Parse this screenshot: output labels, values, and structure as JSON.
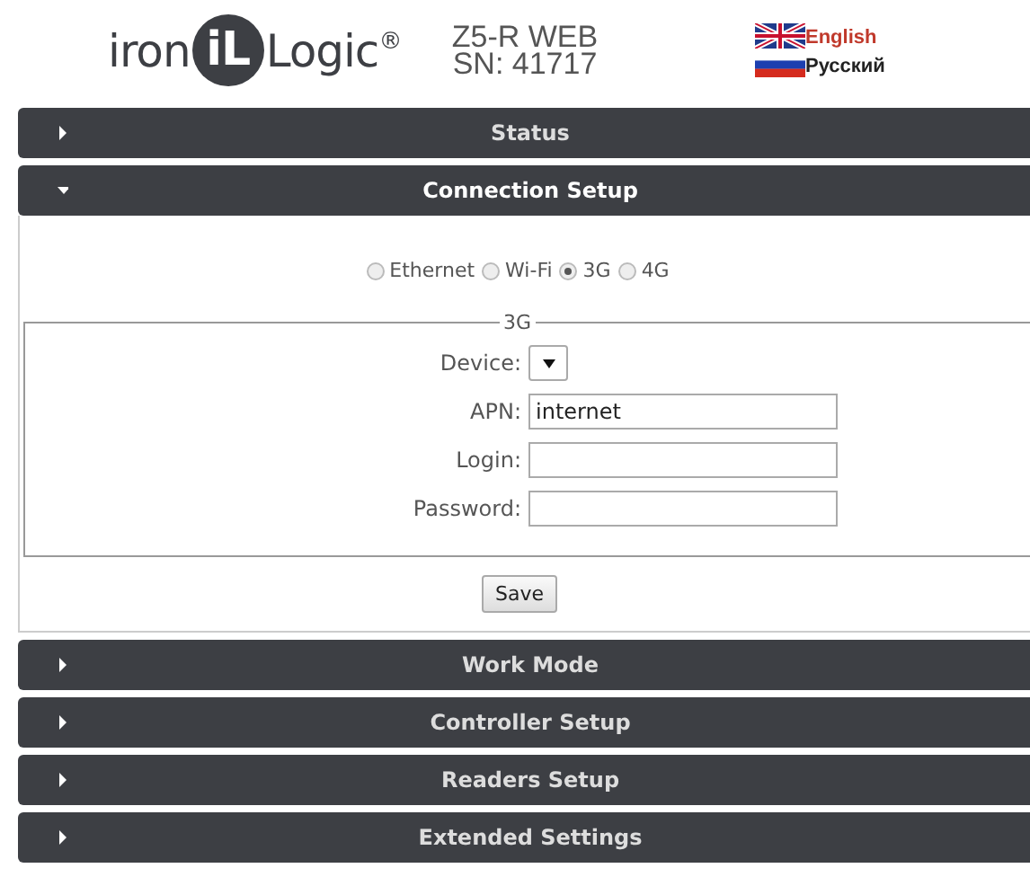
{
  "header": {
    "logo": {
      "left": "iron",
      "mark": "iL",
      "right": "Logic",
      "registered": "®"
    },
    "model": "Z5-R WEB",
    "serial": "SN: 41717",
    "languages": [
      {
        "label": "English",
        "kind": "uk",
        "selected": true
      },
      {
        "label": "Русский",
        "kind": "ru",
        "selected": false
      }
    ]
  },
  "sections": [
    {
      "title": "Status",
      "expanded": false
    },
    {
      "title": "Connection Setup",
      "expanded": true,
      "connection_types": [
        {
          "label": "Ethernet",
          "selected": false
        },
        {
          "label": "Wi-Fi",
          "selected": false
        },
        {
          "label": "3G",
          "selected": true
        },
        {
          "label": "4G",
          "selected": false
        }
      ],
      "fieldset": {
        "legend": "3G",
        "fields": [
          {
            "kind": "select",
            "label": "Device:"
          },
          {
            "kind": "text",
            "label": "APN:",
            "value": "internet"
          },
          {
            "kind": "text",
            "label": "Login:"
          },
          {
            "kind": "password",
            "label": "Password:"
          }
        ]
      },
      "save_button": "Save"
    },
    {
      "title": "Work Mode",
      "expanded": false
    },
    {
      "title": "Controller Setup",
      "expanded": false
    },
    {
      "title": "Readers Setup",
      "expanded": false
    },
    {
      "title": "Extended Settings",
      "expanded": false
    }
  ]
}
